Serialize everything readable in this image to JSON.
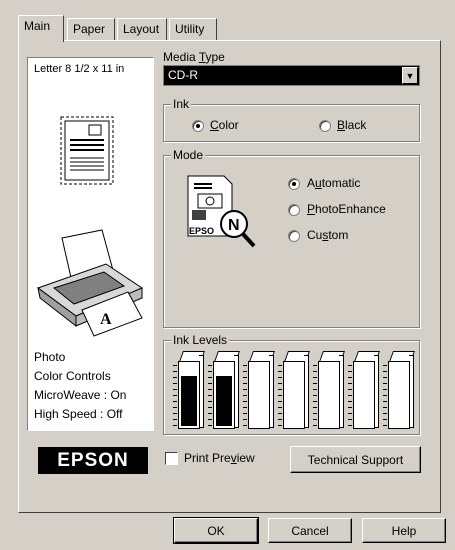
{
  "tabs": [
    {
      "label": "Main",
      "active": true
    },
    {
      "label": "Paper",
      "active": false
    },
    {
      "label": "Layout",
      "active": false
    },
    {
      "label": "Utility",
      "active": false
    }
  ],
  "paper_size": "Letter 8 1/2 x 11 in",
  "settings_summary": [
    "Photo",
    "Color Controls",
    "MicroWeave : On",
    "High Speed : Off"
  ],
  "media_type": {
    "label": "Media Type",
    "value": "CD-R"
  },
  "ink": {
    "label": "Ink",
    "options": [
      {
        "label": "Color",
        "selected": true
      },
      {
        "label": "Black",
        "selected": false
      }
    ]
  },
  "mode": {
    "label": "Mode",
    "options": [
      {
        "label": "Automatic",
        "selected": true
      },
      {
        "label": "PhotoEnhance",
        "selected": false
      },
      {
        "label": "Custom",
        "selected": false
      }
    ],
    "icon_text": "EPSO",
    "icon_badge": "N"
  },
  "ink_levels": {
    "label": "Ink Levels",
    "cartridges": [
      {
        "color": "#000000",
        "level": 0.78
      },
      {
        "color": "#000000",
        "level": 0.78
      },
      {
        "color": "#ffffff",
        "level": 0.0
      },
      {
        "color": "#ffffff",
        "level": 0.0
      },
      {
        "color": "#ffffff",
        "level": 0.0
      },
      {
        "color": "#ffffff",
        "level": 0.0
      },
      {
        "color": "#ffffff",
        "level": 0.0
      }
    ]
  },
  "brand": "EPSON",
  "print_preview": {
    "label": "Print Preview",
    "checked": false
  },
  "technical_support": "Technical Support",
  "buttons": {
    "ok": "OK",
    "cancel": "Cancel",
    "help": "Help"
  },
  "printer_paper_letter": "A"
}
